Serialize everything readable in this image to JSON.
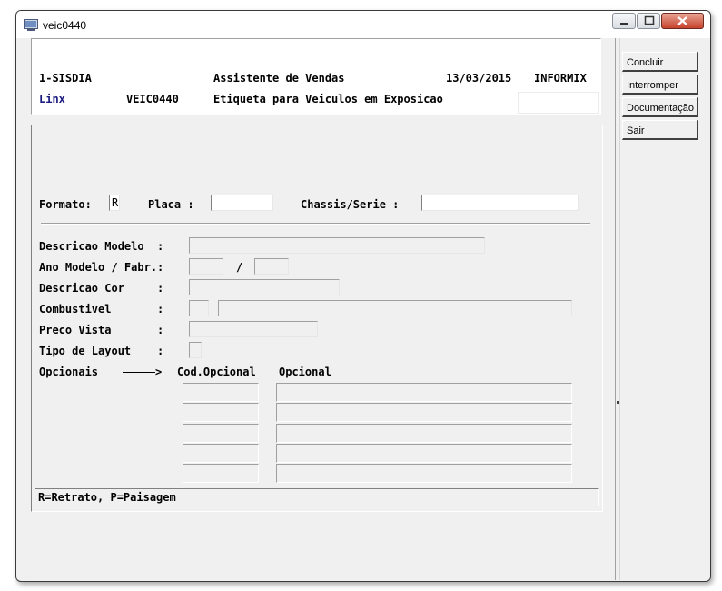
{
  "window": {
    "title": "veic0440",
    "controls": [
      "minimize-icon",
      "maximize-icon",
      "close-icon"
    ]
  },
  "header": {
    "system": "1-SISDIA",
    "company": "Linx",
    "app_title": "Assistente de Vendas",
    "program": "VEIC0440",
    "subtitle": "Etiqueta para Veiculos em Exposicao",
    "date": "13/03/2015",
    "db": "INFORMIX"
  },
  "form": {
    "formato_label": "Formato:",
    "formato_value": "R",
    "placa_label": "Placa :",
    "placa_value": "",
    "chassis_label": "Chassis/Serie :",
    "chassis_value": "",
    "descricao_modelo_label": "Descricao Modelo  :",
    "ano_label": "Ano Modelo / Fabr.:",
    "ano_sep": "/",
    "descricao_cor_label": "Descricao Cor     :",
    "combustivel_label": "Combustivel       :",
    "preco_label": "Preco Vista       :",
    "tipo_layout_label": "Tipo de Layout    :",
    "opcionais_label": "Opcionais",
    "arrow": ">",
    "cod_opcional_header": "Cod.Opcional",
    "opcional_header": "Opcional",
    "opcionais_rows": 5
  },
  "status_bar": {
    "text": "R=Retrato, P=Paisagem"
  },
  "side_buttons": {
    "concluir": "Concluir",
    "interromper": "Interromper",
    "documentacao": "Documentação",
    "sair": "Sair"
  }
}
